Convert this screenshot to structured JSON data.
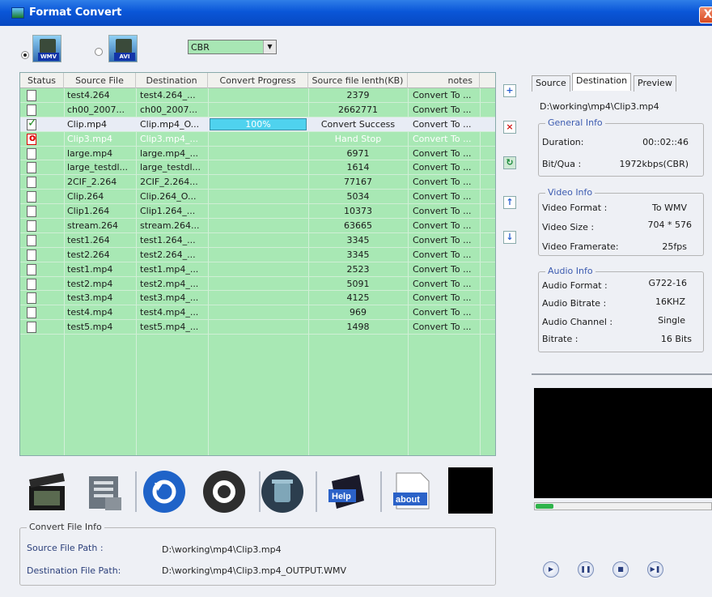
{
  "window": {
    "title": "Format Convert",
    "close": "X"
  },
  "format": {
    "options": [
      {
        "label": "WMV",
        "selected": true
      },
      {
        "label": "AVI",
        "selected": false
      }
    ],
    "bitrate_mode": "CBR"
  },
  "table": {
    "columns": [
      "Status",
      "Source File",
      "Destination",
      "Convert Progress",
      "Source file lenth(KB)",
      "notes"
    ],
    "rows": [
      {
        "status": "pending",
        "source": "test4.264",
        "dest": "test4.264_...",
        "progress": "",
        "size": "2379",
        "notes": "Convert To ..."
      },
      {
        "status": "pending",
        "source": "ch00_2007...",
        "dest": "ch00_2007...",
        "progress": "",
        "size": "2662771",
        "notes": "Convert To ..."
      },
      {
        "status": "done",
        "source": "Clip.mp4",
        "dest": "Clip.mp4_O...",
        "progress": "100%",
        "size": "Convert Success",
        "notes": "Convert To ..."
      },
      {
        "status": "stopped",
        "source": "Clip3.mp4",
        "dest": "Clip3.mp4_...",
        "progress": "",
        "size": "Hand Stop",
        "notes": "Convert To ..."
      },
      {
        "status": "pending",
        "source": "large.mp4",
        "dest": "large.mp4_...",
        "progress": "",
        "size": "6971",
        "notes": "Convert To ..."
      },
      {
        "status": "pending",
        "source": "large_testdl...",
        "dest": "large_testdl...",
        "progress": "",
        "size": "1614",
        "notes": "Convert To ..."
      },
      {
        "status": "pending",
        "source": "2CIF_2.264",
        "dest": "2CIF_2.264...",
        "progress": "",
        "size": "77167",
        "notes": "Convert To ..."
      },
      {
        "status": "pending",
        "source": "Clip.264",
        "dest": "Clip.264_O...",
        "progress": "",
        "size": "5034",
        "notes": "Convert To ..."
      },
      {
        "status": "pending",
        "source": "Clip1.264",
        "dest": "Clip1.264_...",
        "progress": "",
        "size": "10373",
        "notes": "Convert To ..."
      },
      {
        "status": "pending",
        "source": "stream.264",
        "dest": "stream.264...",
        "progress": "",
        "size": "63665",
        "notes": "Convert To ..."
      },
      {
        "status": "pending",
        "source": "test1.264",
        "dest": "test1.264_...",
        "progress": "",
        "size": "3345",
        "notes": "Convert To ..."
      },
      {
        "status": "pending",
        "source": "test2.264",
        "dest": "test2.264_...",
        "progress": "",
        "size": "3345",
        "notes": "Convert To ..."
      },
      {
        "status": "pending",
        "source": "test1.mp4",
        "dest": "test1.mp4_...",
        "progress": "",
        "size": "2523",
        "notes": "Convert To ..."
      },
      {
        "status": "pending",
        "source": "test2.mp4",
        "dest": "test2.mp4_...",
        "progress": "",
        "size": "5091",
        "notes": "Convert To ..."
      },
      {
        "status": "pending",
        "source": "test3.mp4",
        "dest": "test3.mp4_...",
        "progress": "",
        "size": "4125",
        "notes": "Convert To ..."
      },
      {
        "status": "pending",
        "source": "test4.mp4",
        "dest": "test4.mp4_...",
        "progress": "",
        "size": "969",
        "notes": "Convert To ..."
      },
      {
        "status": "pending",
        "source": "test5.mp4",
        "dest": "test5.mp4_...",
        "progress": "",
        "size": "1498",
        "notes": "Convert To ..."
      }
    ]
  },
  "side_buttons": [
    "add-icon",
    "remove-icon",
    "import-icon",
    "move-up-icon",
    "move-down-icon"
  ],
  "toolbar": {
    "buttons": [
      "clapperboard-icon",
      "film-settings-icon",
      "refresh-icon",
      "stop-icon",
      "trash-icon",
      "help-book-icon",
      "about-icon"
    ],
    "help_label": "Help",
    "about_label": "about"
  },
  "convert_info": {
    "legend": "Convert File Info",
    "source_label": "Source File Path    :",
    "source_value": "D:\\working\\mp4\\Clip3.mp4",
    "dest_label": "Destination File Path:",
    "dest_value": "D:\\working\\mp4\\Clip3.mp4_OUTPUT.WMV"
  },
  "details": {
    "tabs": [
      "Source",
      "Destination",
      "Preview"
    ],
    "active_tab": "Destination",
    "path": "D:\\working\\mp4\\Clip3.mp4",
    "general": {
      "legend": "General Info",
      "duration_label": "Duration:",
      "duration": "00::02::46",
      "bitqua_label": "Bit/Qua :",
      "bitqua": "1972kbps(CBR)"
    },
    "video": {
      "legend": "Video Info",
      "format_label": "Video Format  :",
      "format": "To WMV",
      "size_label": "Video Size    :",
      "size": "704 * 576",
      "framerate_label": "Video Framerate:",
      "framerate": "25fps"
    },
    "audio": {
      "legend": "Audio Info",
      "format_label": "Audio Format  :",
      "format": "G722-16",
      "bitrate_label": "Audio Bitrate  :",
      "bitrate": "16KHZ",
      "channel_label": "Audio Channel  :",
      "channel": "Single",
      "bits_label": "Bitrate     :",
      "bits": "16 Bits"
    }
  },
  "player": {
    "position_fraction": 0.1,
    "controls": [
      "play-icon",
      "pause-icon",
      "stop-icon",
      "next-frame-icon"
    ]
  },
  "colors": {
    "titlebar": "#0a56d8",
    "grid_bg": "#a8e8b4",
    "progress": "#4fd2ee"
  }
}
